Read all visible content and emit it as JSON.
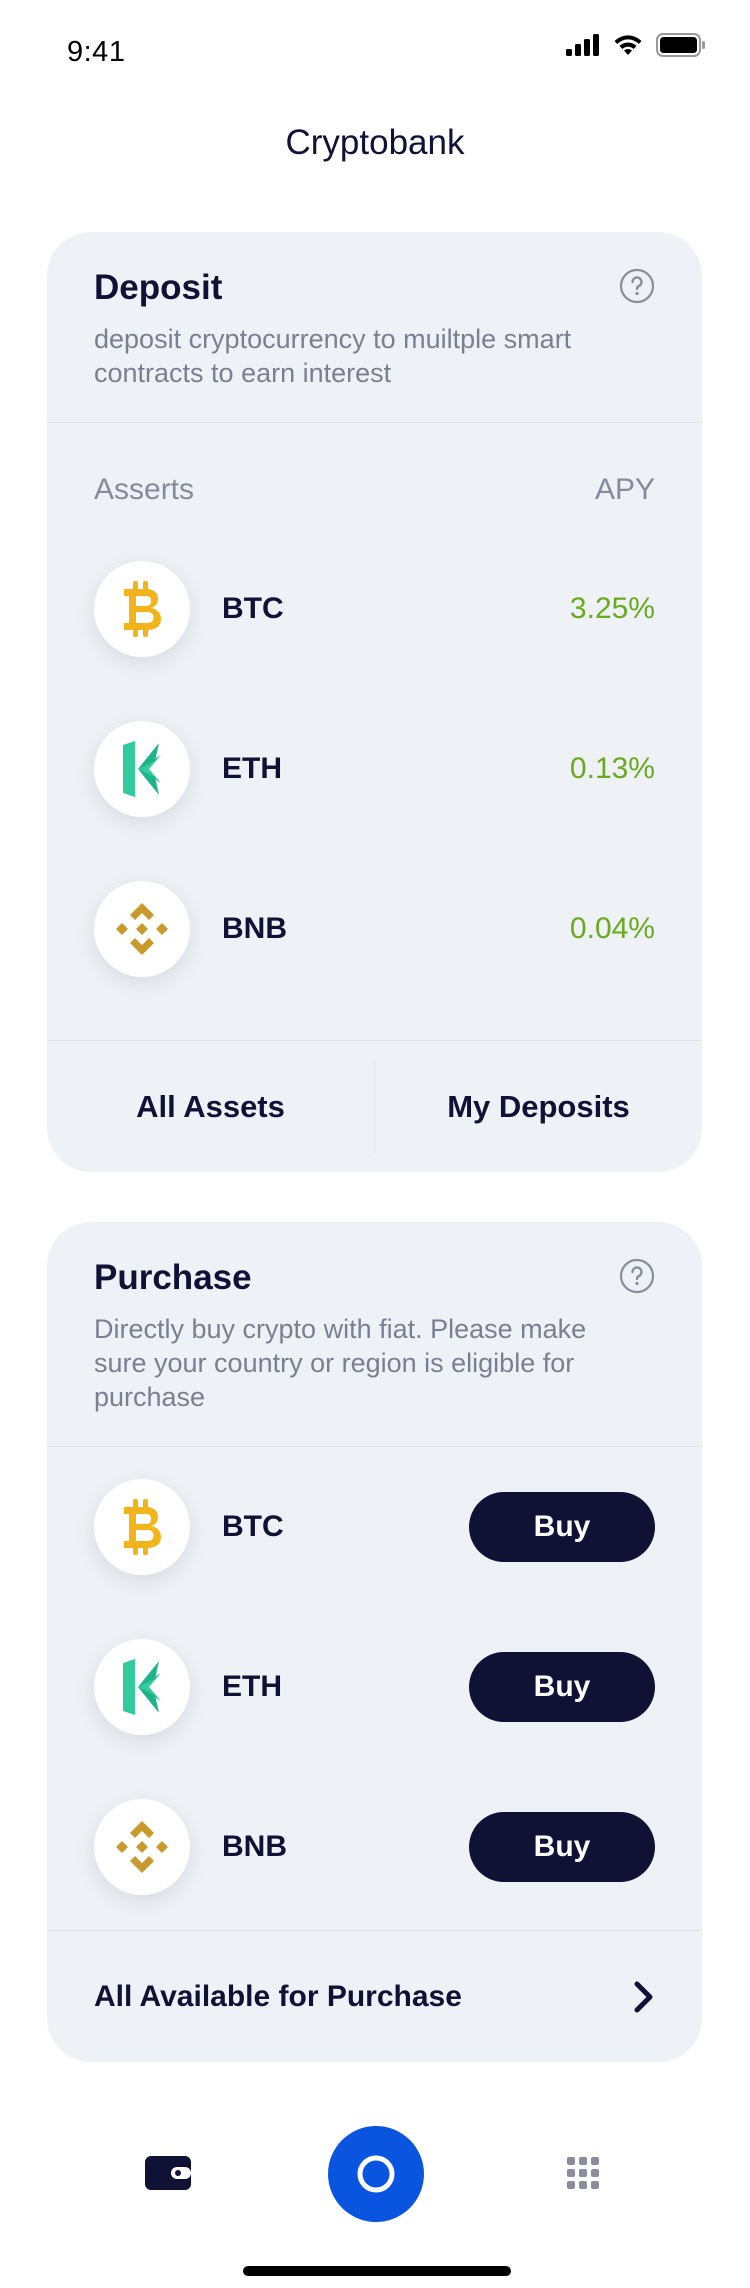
{
  "status_bar": {
    "time": "9:41"
  },
  "header": {
    "title": "Cryptobank"
  },
  "deposit": {
    "title": "Deposit",
    "description": "deposit cryptocurrency to muiltple smart contracts to earn interest",
    "col_asset": "Asserts",
    "col_apy": "APY",
    "coins": [
      {
        "symbol": "BTC",
        "apy": "3.25%",
        "icon": "bitcoin-icon"
      },
      {
        "symbol": "ETH",
        "apy": "0.13%",
        "icon": "kyber-icon"
      },
      {
        "symbol": "BNB",
        "apy": "0.04%",
        "icon": "binance-icon"
      }
    ],
    "all_assets": "All Assets",
    "my_deposits": "My Deposits"
  },
  "purchase": {
    "title": "Purchase",
    "description": "Directly buy crypto with fiat. Please make sure your country or region is eligible for purchase",
    "coins": [
      {
        "symbol": "BTC",
        "icon": "bitcoin-icon"
      },
      {
        "symbol": "ETH",
        "icon": "kyber-icon"
      },
      {
        "symbol": "BNB",
        "icon": "binance-icon"
      }
    ],
    "buy_label": "Buy",
    "all_available": "All Available for Purchase"
  },
  "tab_bar": {
    "items": [
      "wallet-icon",
      "home-circle-icon",
      "grid-icon"
    ],
    "active_color": "#0a55e0"
  },
  "colors": {
    "primary": "#0f1235",
    "accent": "#0a55e0",
    "positive": "#6aaa1f",
    "btc": "#f2b41b",
    "eth": "#31cb9e",
    "bnb": "#c79a2b"
  }
}
